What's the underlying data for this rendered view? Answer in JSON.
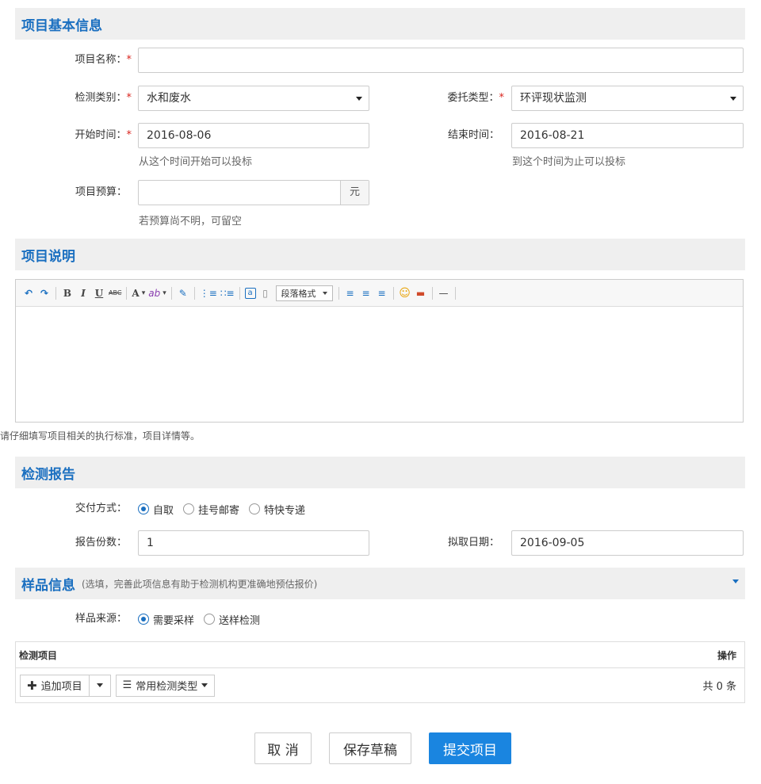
{
  "sections": {
    "basic": "项目基本信息",
    "desc": "项目说明",
    "report": "检测报告",
    "sample": "样品信息",
    "sample_note": "(选填，完善此项信息有助于检测机构更准确地预估报价)"
  },
  "basic": {
    "name_label": "项目名称：",
    "name_value": "",
    "category_label": "检测类别：",
    "category_value": "水和废水",
    "entrust_label": "委托类型：",
    "entrust_value": "环评现状监测",
    "start_label": "开始时间：",
    "start_value": "2016-08-06",
    "start_hint": "从这个时间开始可以投标",
    "end_label": "结束时间：",
    "end_value": "2016-08-21",
    "end_hint": "到这个时间为止可以投标",
    "budget_label": "项目预算：",
    "budget_value": "",
    "budget_unit": "元",
    "budget_hint": "若预算尚不明，可留空",
    "required_mark": "*"
  },
  "editor": {
    "toolbar": {
      "undo_icon": "↶",
      "redo_icon": "↷",
      "bold": "B",
      "italic": "I",
      "underline": "U",
      "strike": "ABC",
      "font_color": "A",
      "highlight": "ab",
      "eraser": "✎",
      "ol": "⋮≡",
      "ul": "∷≡",
      "anchor": "a",
      "page": "▯",
      "paragraph": "段落格式",
      "align_left": "≡",
      "align_center": "≡",
      "align_right": "≡",
      "emoji": "☺",
      "image": "▬",
      "hr": "—"
    },
    "hint": "请仔细填写项目相关的执行标准，项目详情等。"
  },
  "report": {
    "delivery_label": "交付方式：",
    "delivery_options": [
      "自取",
      "挂号邮寄",
      "特快专递"
    ],
    "delivery_selected": "自取",
    "copies_label": "报告份数：",
    "copies_value": "1",
    "date_label": "拟取日期：",
    "date_value": "2016-09-05"
  },
  "sample": {
    "source_label": "样品来源：",
    "source_options": [
      "需要采样",
      "送样检测"
    ],
    "source_selected": "需要采样",
    "table": {
      "col_item": "检测项目",
      "col_action": "操作",
      "add_button": "追加项目",
      "common_types_button": "常用检测类型",
      "count": "共 0 条"
    }
  },
  "actions": {
    "cancel": "取 消",
    "save_draft": "保存草稿",
    "submit": "提交项目"
  },
  "colors": {
    "accent": "#1a6fc0",
    "primary_button": "#1a85e0",
    "required": "#d9231d"
  }
}
